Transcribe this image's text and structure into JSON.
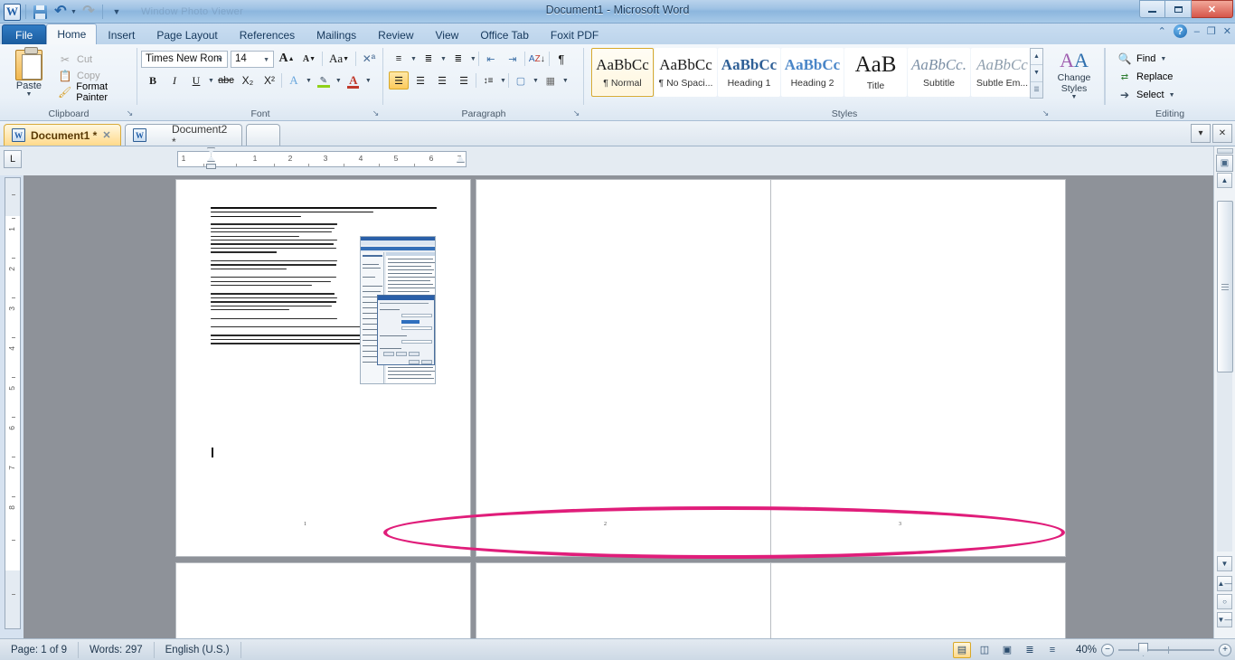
{
  "window": {
    "title": "Document1 - Microsoft Word",
    "quick_access": [
      {
        "name": "word-logo",
        "label": "W"
      },
      {
        "name": "save",
        "label": "Save"
      },
      {
        "name": "undo",
        "label": "Undo"
      },
      {
        "name": "redo",
        "label": "Redo"
      },
      {
        "name": "customize-qat",
        "label": "Customize Quick Access Toolbar"
      }
    ],
    "controls": {
      "minimize": "–",
      "restore": "❐",
      "close": "✕"
    },
    "ribbon_controls": {
      "collapse": "⌃",
      "help": "?",
      "min": "–",
      "restore": "❐",
      "close": "✕"
    }
  },
  "ribbon": {
    "tabs": [
      {
        "label": "File",
        "kind": "file"
      },
      {
        "label": "Home",
        "kind": "active"
      },
      {
        "label": "Insert",
        "kind": "normal"
      },
      {
        "label": "Page Layout",
        "kind": "normal"
      },
      {
        "label": "References",
        "kind": "normal"
      },
      {
        "label": "Mailings",
        "kind": "normal"
      },
      {
        "label": "Review",
        "kind": "normal"
      },
      {
        "label": "View",
        "kind": "normal"
      },
      {
        "label": "Office Tab",
        "kind": "normal"
      },
      {
        "label": "Foxit PDF",
        "kind": "normal"
      }
    ],
    "clipboard": {
      "group_label": "Clipboard",
      "paste_label": "Paste",
      "cut_label": "Cut",
      "copy_label": "Copy",
      "format_painter_label": "Format Painter"
    },
    "font": {
      "group_label": "Font",
      "font_name": "Times New Rom",
      "font_size": "14",
      "grow_font": "A",
      "shrink_font": "A",
      "change_case": "Aa",
      "clear_formatting": "✐",
      "bold": "B",
      "italic": "I",
      "underline": "U",
      "strikethrough": "abc",
      "subscript": "X₂",
      "superscript": "X²",
      "text_effects": "A",
      "highlight": "ab",
      "font_color": "A"
    },
    "paragraph": {
      "group_label": "Paragraph",
      "bullets": "•≡",
      "numbering": "1≡",
      "multilevel": "≡",
      "decrease_indent": "⇤",
      "increase_indent": "⇥",
      "sort": "A↓",
      "show_marks": "¶",
      "align_left": "≡",
      "align_center": "≡",
      "align_right": "≡",
      "justify": "≡",
      "line_spacing": "↕≡",
      "shading": "▣",
      "borders": "▦"
    },
    "styles": {
      "group_label": "Styles",
      "items": [
        {
          "sample": "AaBbCс",
          "name": "¶ Normal",
          "selected": true
        },
        {
          "sample": "AaBbCс",
          "name": "¶ No Spaci...",
          "selected": false
        },
        {
          "sample": "AaBbCс",
          "name": "Heading 1",
          "selected": false
        },
        {
          "sample": "AaBbCc",
          "name": "Heading 2",
          "selected": false
        },
        {
          "sample": "AaB",
          "name": "Title",
          "selected": false
        },
        {
          "sample": "AaBbCc.",
          "name": "Subtitle",
          "selected": false
        },
        {
          "sample": "AaBbCс",
          "name": "Subtle Em...",
          "selected": false
        }
      ],
      "change_styles_label": "Change Styles"
    },
    "editing": {
      "group_label": "Editing",
      "find_label": "Find",
      "replace_label": "Replace",
      "select_label": "Select"
    }
  },
  "office_tabs": {
    "tabs": [
      {
        "label": "Document1 *",
        "active": true,
        "closable": true
      },
      {
        "label": "Document2 *",
        "active": false,
        "closable": false
      }
    ],
    "menu_button": "▾",
    "close_button": "✕"
  },
  "ruler": {
    "tab_selector": "L",
    "h_numbers": [
      "1",
      "1",
      "2",
      "3",
      "4",
      "5",
      "6",
      "7"
    ],
    "v_numbers": [
      "1",
      "2",
      "3",
      "4",
      "5",
      "6",
      "7",
      "8"
    ]
  },
  "document": {
    "page_numbers": [
      "1",
      "2",
      "3"
    ],
    "heading": "TP - Tiện ích \"spooler\" là một phần mềm tạm thời lưu trữ các công việc in trên ổ cứng hoặc bộ nhớ của máy tính cho đến khi máy in ở chế độ sẵn sàng hoạt động.",
    "paragraphs": [
      "Nếu thời gian đợi để in một văn bản lâu hơn thường lệ hoặc bạn gặp thông báo về lỗi \"spooler\" của máy in, bạn cần khởi động lại tiện ích Print Spooler trên máy tính của bạn.",
      "Để khắc phục lỗi, chúng tôi khuyên bạn nên lưu lại toàn bộ các công việc đang thực hiện trên máy và khởi động lại máy tính nhằm khởi động lại tiện ích Print Spooler.",
      "Nếu bạn không muốn khởi động lại máy tính, bạn làm theo hướng dẫn dưới đây. (Lưu ý: Bạn cần phải đăng nhập bằng tài khoản administrator để thực hiện các thao tác này).",
      "- Mở cửa sổ Administrative Tools bằng cách kích chuột vào các biểu tượng Start, Control Panel, System and Maintenance, Administrative Tools.",
      "- Tiếp đó, kích đúp chuột vào Services. Tại đây, nếu bạn nhận được thông báo nhập mật khẩu administrator hoặc xác nhận lại thông tin, bạn gõ lại mật khẩu hoặc kích chuột vào nút bấm OK để xác nhận lại thông tin.",
      "- Kích chuột phải vào tiện ích Print Spooler, Properties.",
      "- Trên thẻ General, bạn tìm tới mục Startup type, chọn tính năng Automatic (nếu chưa có).",
      "- Nếu tiện ích trên chưa được khởi động, bạn tìm tới mục Service status, kích chuột vào Start, OK để khởi động. Tại đây, nếu bạn nhận được thông báo nhập mật khẩu administrator hoặc xác nhận lại thông tin, bạn gõ lại mật khẩu hoặc kích chuột vào nút bấm OK để xác nhận lại thông tin."
    ]
  },
  "annotation": {
    "shape": "ellipse",
    "color": "#e01d7a"
  },
  "statusbar": {
    "page": "Page: 1 of 9",
    "words": "Words: 297",
    "language": "English (U.S.)",
    "views": [
      {
        "name": "print-layout-view",
        "glyph": "▤",
        "selected": true
      },
      {
        "name": "full-screen-reading-view",
        "glyph": "◫",
        "selected": false
      },
      {
        "name": "web-layout-view",
        "glyph": "▣",
        "selected": false
      },
      {
        "name": "outline-view",
        "glyph": "≣",
        "selected": false
      },
      {
        "name": "draft-view",
        "glyph": "≡",
        "selected": false
      }
    ],
    "zoom": "40%",
    "zoom_out": "−",
    "zoom_in": "+"
  }
}
